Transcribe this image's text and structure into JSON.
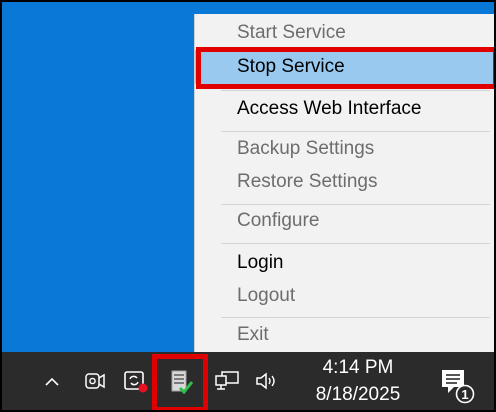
{
  "menu": {
    "items": [
      {
        "label": "Start Service",
        "enabled": false
      },
      {
        "label": "Stop Service",
        "enabled": true,
        "highlighted": true
      },
      {
        "label": "Access Web Interface",
        "enabled": true
      },
      {
        "label": "Backup Settings",
        "enabled": false
      },
      {
        "label": "Restore Settings",
        "enabled": false
      },
      {
        "label": "Configure",
        "enabled": false
      },
      {
        "label": "Login",
        "enabled": true
      },
      {
        "label": "Logout",
        "enabled": false
      },
      {
        "label": "Exit",
        "enabled": false
      }
    ]
  },
  "taskbar": {
    "icons": [
      "chevron-up-icon",
      "camera-icon",
      "sync-icon",
      "service-tray-icon",
      "network-icon",
      "speaker-icon",
      "notification-icon"
    ],
    "time": "4:14 PM",
    "date": "8/18/2025",
    "notification_count": "1"
  },
  "colors": {
    "desktop": "#0a78d7",
    "menu_bg": "#f2f2f2",
    "highlight": "#99c9ef",
    "annotation_red": "#e00000",
    "taskbar": "#2b2b2b"
  }
}
